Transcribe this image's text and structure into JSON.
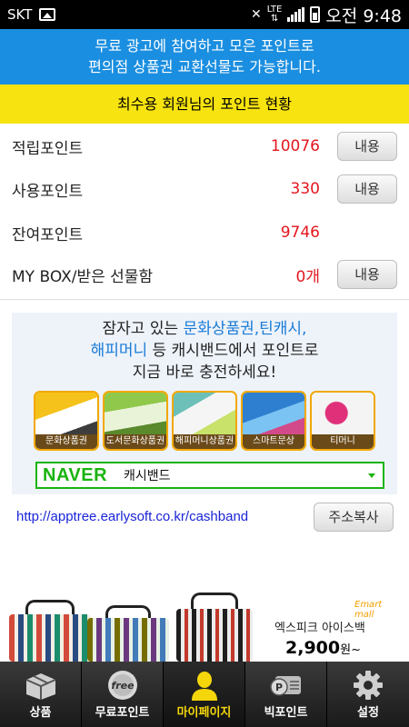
{
  "status_bar": {
    "carrier": "SKT",
    "network": "LTE",
    "time": "오전 9:48",
    "icons": [
      "image-icon",
      "mute-icon",
      "signal-icon",
      "battery-icon"
    ]
  },
  "banner": {
    "line1": "무료 광고에 참여하고 모은 포인트로",
    "line2": "편의점 상품권 교환선물도 가능합니다.",
    "color": "#1a8ee0"
  },
  "points_header": {
    "title": "최수용 회원님의 포인트 현황",
    "color": "#f7e30f"
  },
  "points": {
    "accumulated": {
      "label": "적립포인트",
      "value": "10076",
      "button": "내용"
    },
    "used": {
      "label": "사용포인트",
      "value": "330",
      "button": "내용"
    },
    "remaining": {
      "label": "잔여포인트",
      "value": "9746"
    },
    "mybox": {
      "label": "MY BOX/받은 선물함",
      "value": "0개",
      "button": "내용"
    },
    "value_color": "#e4161e"
  },
  "promo": {
    "line1_pre": "잠자고 있는 ",
    "line1_blue": "문화상품권,틴캐시,",
    "line2_blue": "해피머니",
    "line2_post": " 등 캐시밴드에서 포인트로",
    "line3": "지금 바로 충전하세요!",
    "tiles": [
      {
        "label": "문화상품권",
        "icon": "culture-voucher-icon"
      },
      {
        "label": "도서문화상품권",
        "icon": "book-voucher-icon"
      },
      {
        "label": "해피머니상품권",
        "icon": "happymoney-icon"
      },
      {
        "label": "스마트문상",
        "icon": "smart-voucher-icon"
      },
      {
        "label": "티머니",
        "icon": "tmoney-icon"
      }
    ],
    "search": {
      "brand": "NAVER",
      "keyword": "캐시밴드"
    }
  },
  "link": {
    "url": "http://apptree.earlysoft.co.kr/cashband",
    "copy_button": "주소복사"
  },
  "ad": {
    "brand": "Emart mall",
    "title": "엑스피크 아이스백",
    "price": "2,900",
    "price_unit": "원~"
  },
  "tabs": [
    {
      "label": "상품",
      "icon": "gift-box-icon",
      "active": false
    },
    {
      "label": "무료포인트",
      "icon": "free-badge-icon",
      "active": false
    },
    {
      "label": "마이페이지",
      "icon": "person-icon",
      "active": true
    },
    {
      "label": "빅포인트",
      "icon": "point-card-icon",
      "active": false
    },
    {
      "label": "설정",
      "icon": "gear-icon",
      "active": false
    }
  ]
}
